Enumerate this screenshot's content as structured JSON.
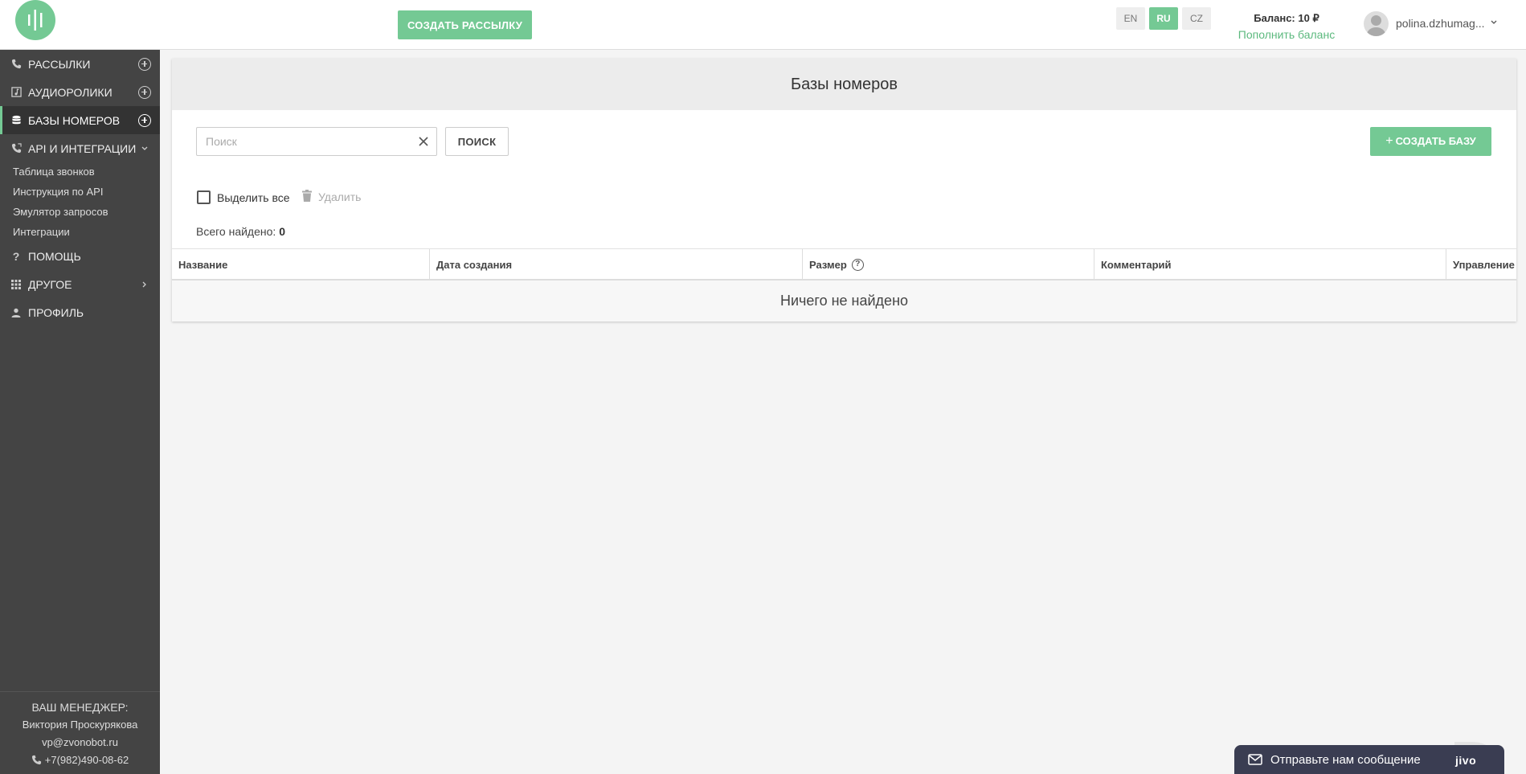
{
  "header": {
    "create_mailing": "СОЗДАТЬ РАССЫЛКУ",
    "languages": [
      {
        "code": "EN",
        "active": false
      },
      {
        "code": "RU",
        "active": true
      },
      {
        "code": "CZ",
        "active": false
      }
    ],
    "balance": "Баланс: 10 ₽",
    "top_up": "Пополнить баланс",
    "username": "polina.dzhumag..."
  },
  "sidebar": {
    "items": [
      {
        "label": "РАССЫЛКИ",
        "icon": "phone-icon"
      },
      {
        "label": "АУДИОРОЛИКИ",
        "icon": "audio-icon"
      },
      {
        "label": "БАЗЫ НОМЕРОВ",
        "icon": "database-icon",
        "active": true
      },
      {
        "label": "API И ИНТЕГРАЦИИ",
        "icon": "phone-link-icon"
      }
    ],
    "sub_items": [
      "Таблица звонков",
      "Инструкция по API",
      "Эмулятор запросов",
      "Интеграции"
    ],
    "bottom_items": [
      {
        "label": "ПОМОЩЬ",
        "icon": "help-icon"
      },
      {
        "label": "ДРУГОЕ",
        "icon": "grid-icon"
      },
      {
        "label": "ПРОФИЛЬ",
        "icon": "person-icon"
      }
    ],
    "manager": {
      "title": "ВАШ МЕНЕДЖЕР:",
      "name": "Виктория Проскурякова",
      "email": "vp@zvonobot.ru",
      "phone": "+7(982)490-08-62"
    }
  },
  "main": {
    "title": "Базы номеров",
    "search_placeholder": "Поиск",
    "search_button": "ПОИСК",
    "create_base": "СОЗДАТЬ БАЗУ",
    "select_all": "Выделить все",
    "delete": "Удалить",
    "total_label": "Всего найдено:",
    "total_value": "0",
    "columns": [
      "Название",
      "Дата создания",
      "Размер",
      "Комментарий",
      "Управление"
    ],
    "empty": "Ничего не найдено"
  },
  "chat": {
    "text": "Отправьте нам сообщение",
    "brand": "jivo"
  },
  "colors": {
    "accent": "#74c994",
    "sidebar": "#444444",
    "chat": "#3a3d52"
  }
}
